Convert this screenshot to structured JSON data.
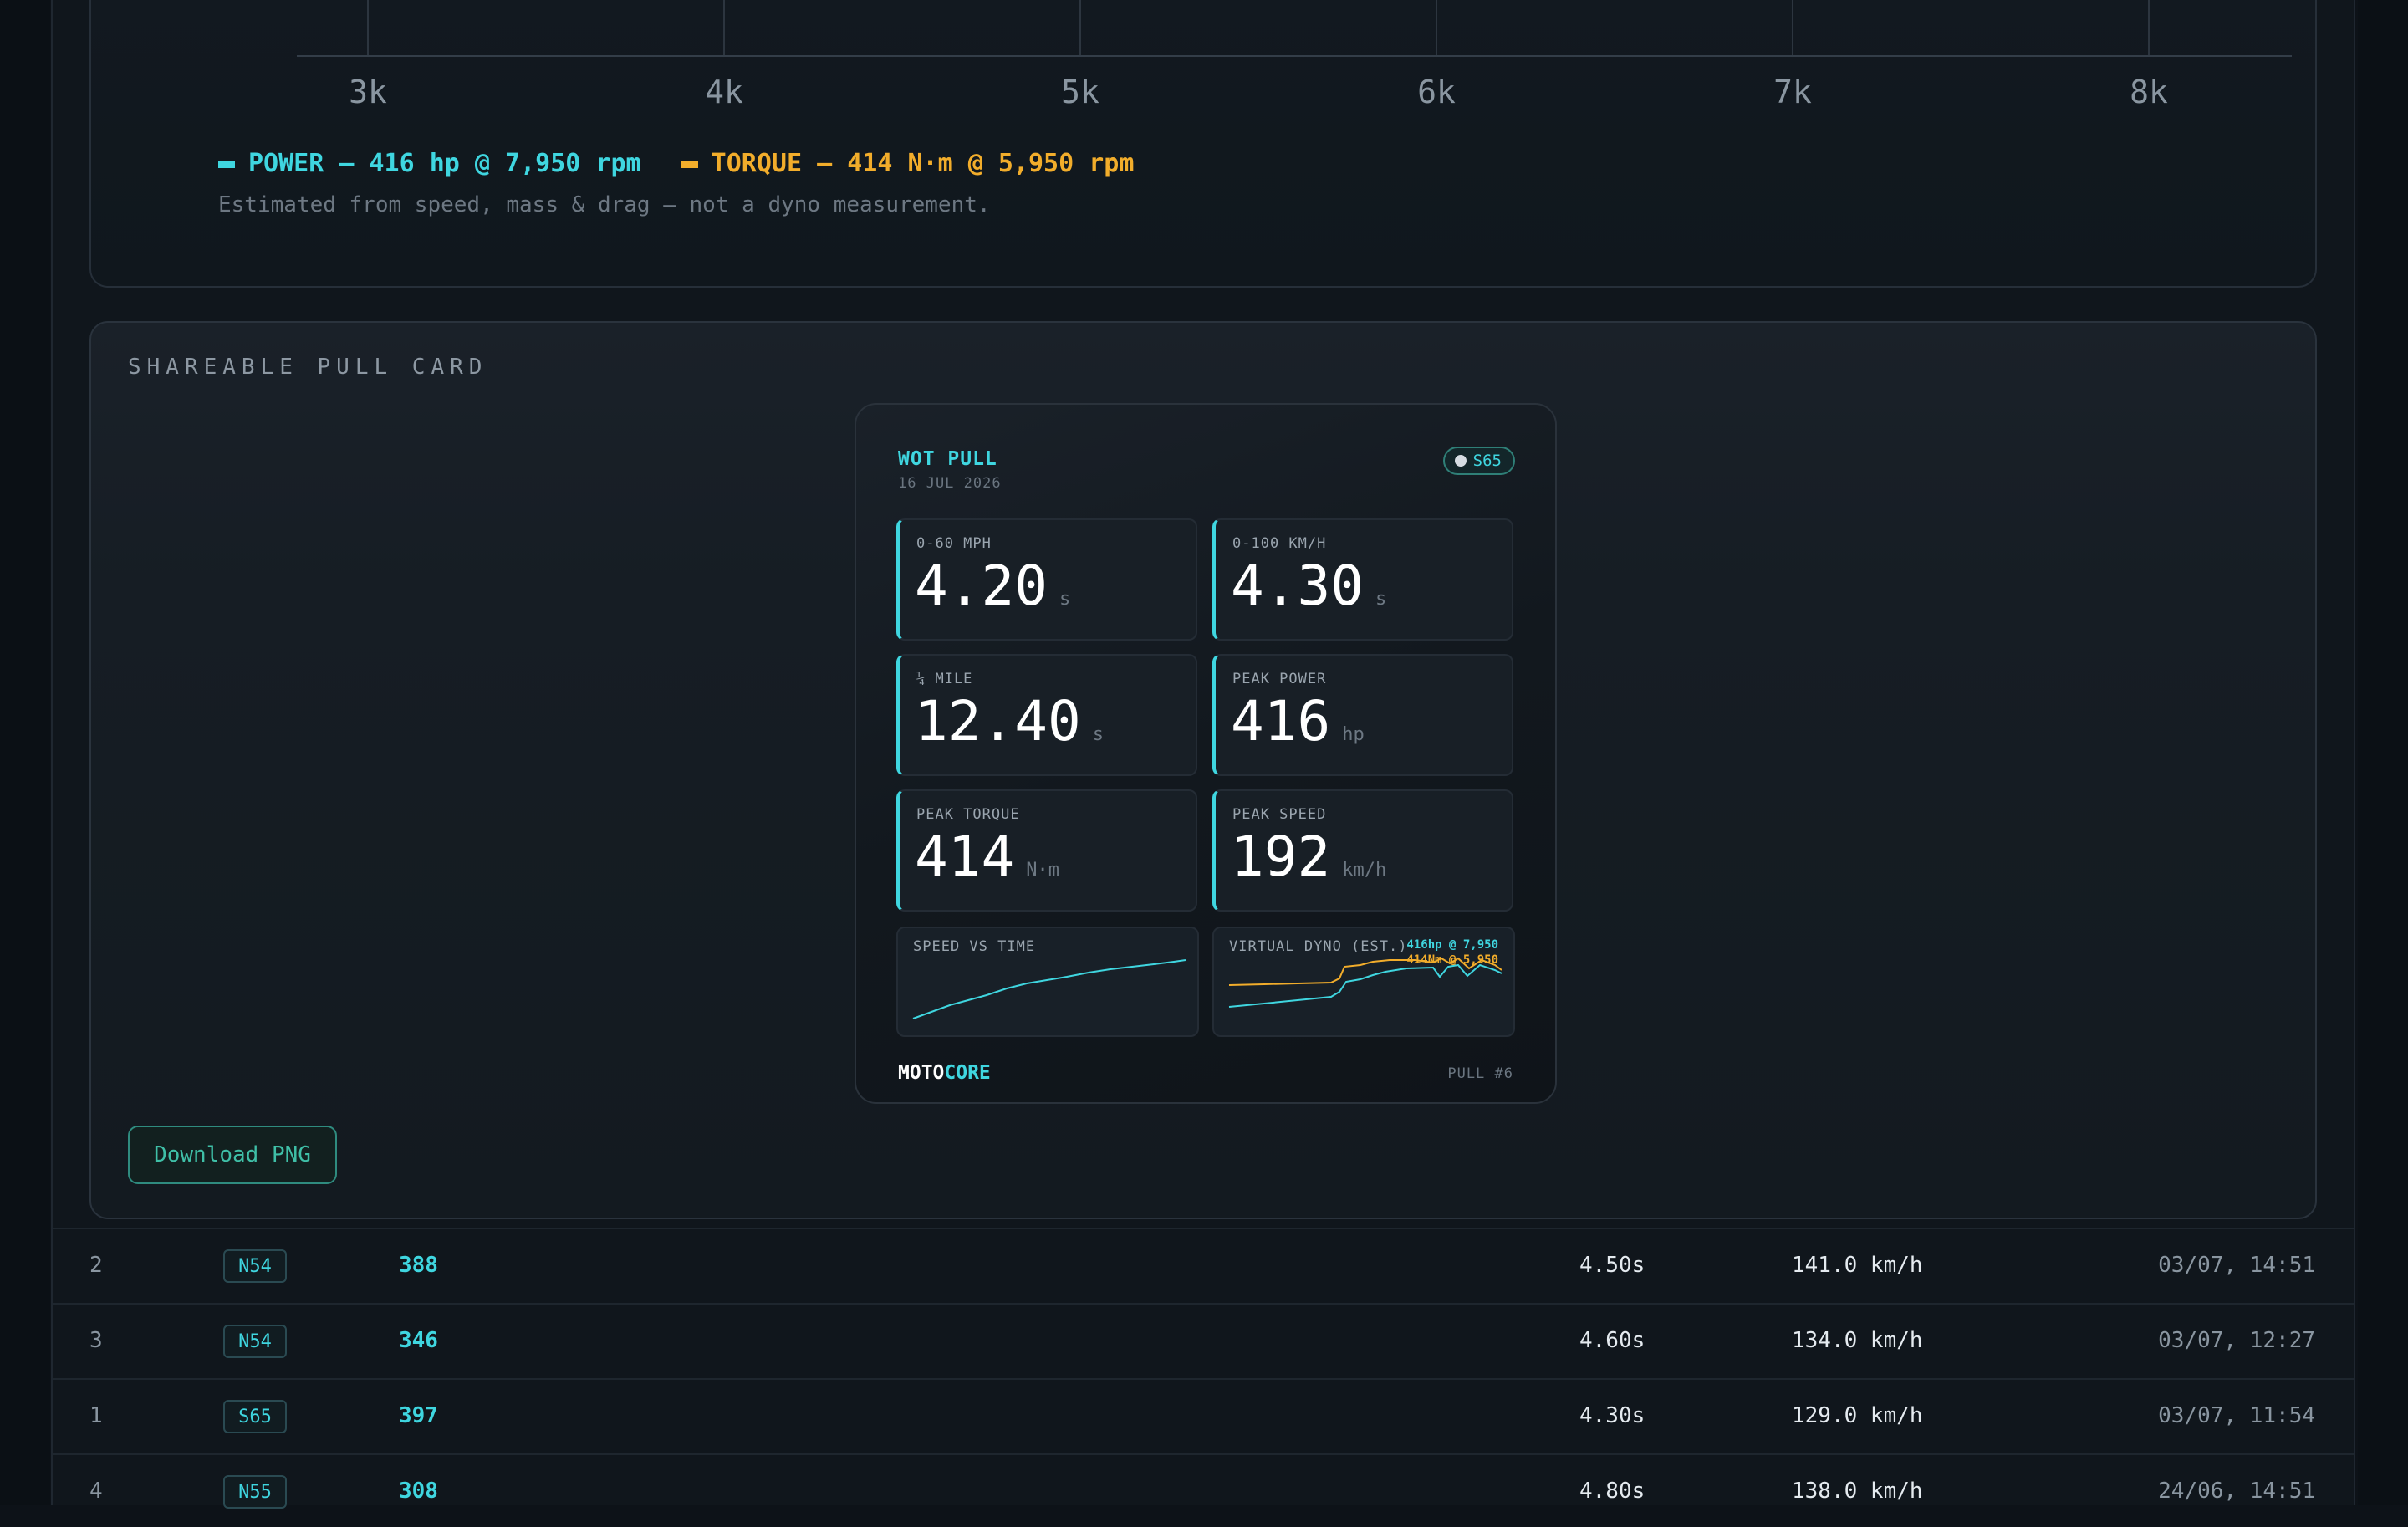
{
  "dyno": {
    "x_ticks": [
      "3k",
      "4k",
      "5k",
      "6k",
      "7k",
      "8k"
    ],
    "power_legend": "POWER — 416 hp @ 7,950 rpm",
    "torque_legend": "TORQUE — 414 N·m @ 5,950 rpm",
    "note": "Estimated from speed, mass & drag — not a dyno measurement.",
    "colors": {
      "power": "#3fd6e0",
      "torque": "#f2ad2b"
    }
  },
  "share": {
    "title": "SHAREABLE PULL CARD",
    "download_label": "Download PNG",
    "card": {
      "title": "WOT PULL",
      "date": "16 JUL 2026",
      "engine_chip": "S65",
      "tiles": [
        {
          "label": "0-60 MPH",
          "value": "4.20",
          "unit": "s"
        },
        {
          "label": "0-100 KM/H",
          "value": "4.30",
          "unit": "s"
        },
        {
          "label": "¼ MILE",
          "value": "12.40",
          "unit": "s"
        },
        {
          "label": "PEAK POWER",
          "value": "416",
          "unit": "hp"
        },
        {
          "label": "PEAK TORQUE",
          "value": "414",
          "unit": "N·m"
        },
        {
          "label": "PEAK SPEED",
          "value": "192",
          "unit": "km/h"
        }
      ],
      "speed_chart_label": "SPEED VS TIME",
      "dyno_chart_label": "VIRTUAL DYNO (EST.)",
      "dyno_power_annotation": "416hp @ 7,950",
      "dyno_torque_annotation": "414Nm @ 5,950",
      "brand_a": "MOTO",
      "brand_b": "CORE",
      "pull_number": "PULL #6"
    }
  },
  "pulls": [
    {
      "num": "2",
      "engine": "N54",
      "hp": "388",
      "time": "4.50s",
      "speed": "141.0 km/h",
      "date": "03/07, 14:51"
    },
    {
      "num": "3",
      "engine": "N54",
      "hp": "346",
      "time": "4.60s",
      "speed": "134.0 km/h",
      "date": "03/07, 12:27"
    },
    {
      "num": "1",
      "engine": "S65",
      "hp": "397",
      "time": "4.30s",
      "speed": "129.0 km/h",
      "date": "03/07, 11:54"
    },
    {
      "num": "4",
      "engine": "N55",
      "hp": "308",
      "time": "4.80s",
      "speed": "138.0 km/h",
      "date": "24/06, 14:51"
    }
  ]
}
